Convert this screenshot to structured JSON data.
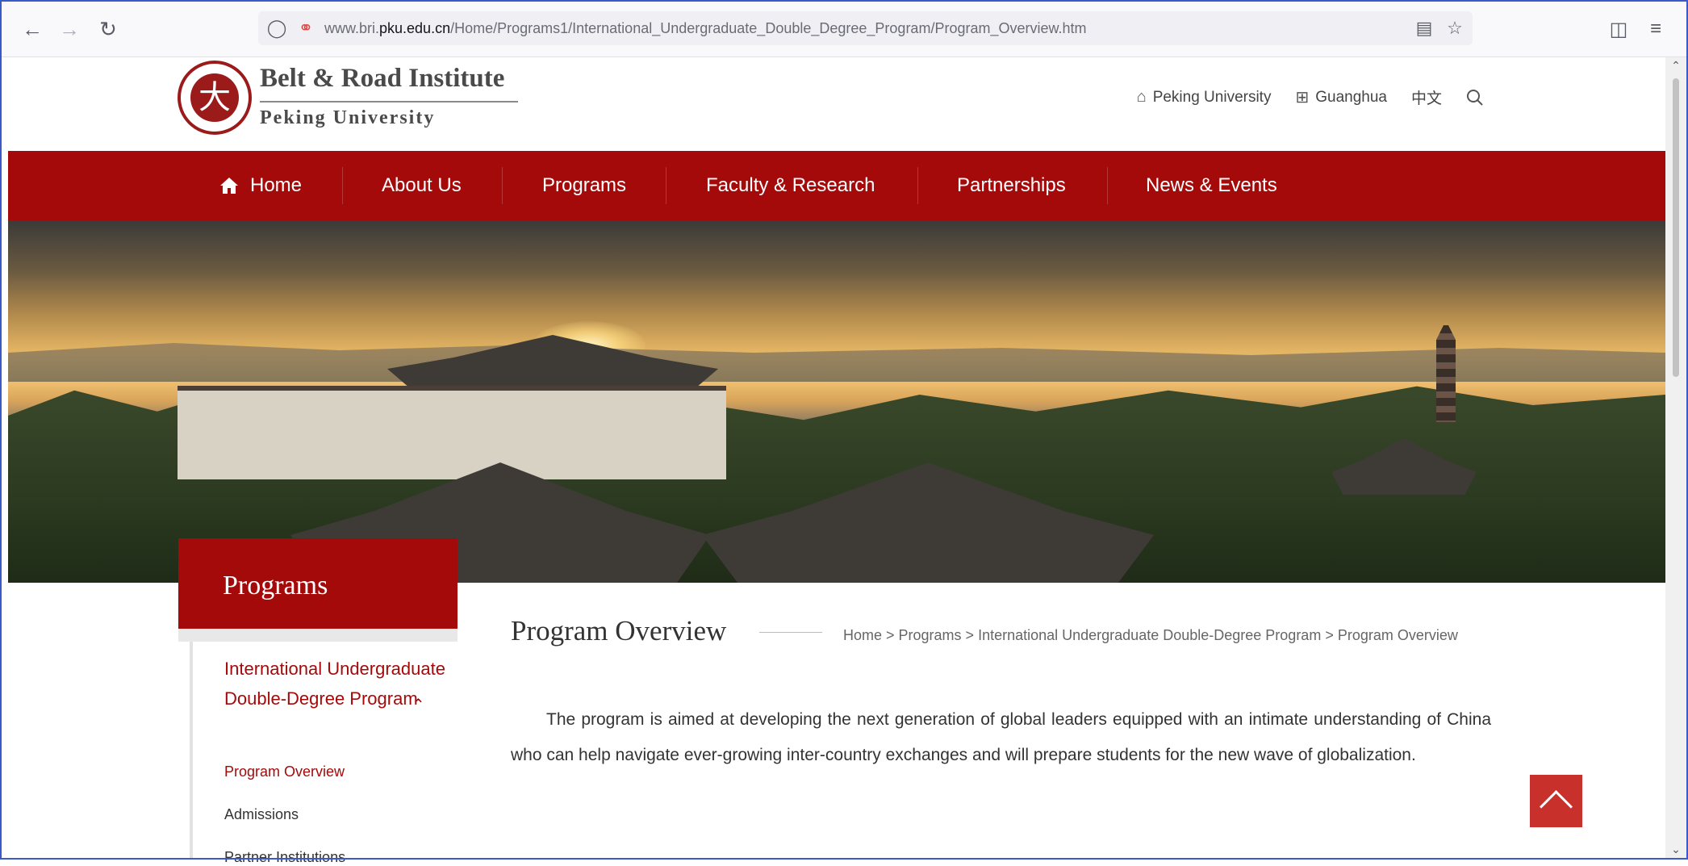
{
  "browser": {
    "nav_back_icon": "arrow-left-icon",
    "nav_forward_icon": "arrow-right-icon",
    "reload_icon": "reload-icon",
    "url_prefix": "www.bri.",
    "url_domain": "pku.edu.cn",
    "url_path": "/Home/Programs1/International_Undergraduate_Double_Degree_Program/Program_Overview.htm",
    "right_icons": [
      "reader-view-icon",
      "bookmark-star-icon",
      "pocket-icon",
      "menu-icon"
    ]
  },
  "header": {
    "logo_title": "Belt & Road Institute",
    "logo_subtitle": "Peking University",
    "seal_glyph": "北大",
    "links": [
      {
        "label": "Peking University",
        "icon": "home-building-icon"
      },
      {
        "label": "Guanghua",
        "icon": "grid-icon"
      },
      {
        "label": "中文",
        "icon": ""
      }
    ]
  },
  "nav": {
    "home": "Home",
    "about": "About Us",
    "programs": "Programs",
    "faculty": "Faculty & Research",
    "partnerships": "Partnerships",
    "news": "News & Events"
  },
  "sidebar": {
    "heading": "Programs",
    "current_section": "International Undergraduate Double-Degree Program",
    "items": [
      {
        "label": "Program Overview",
        "active": true
      },
      {
        "label": "Admissions",
        "active": false
      },
      {
        "label": "Partner Institutions",
        "active": false
      }
    ]
  },
  "content": {
    "title": "Program Overview",
    "breadcrumb": "Home > Programs > International Undergraduate Double-Degree Program > Program Overview",
    "paragraph": "The program is aimed at developing the next generation of global leaders equipped with an intimate understanding of China who can help navigate ever-growing inter-country exchanges and will prepare students for the new wave of globalization."
  },
  "colors": {
    "brand_red": "#a50a0a",
    "to_top_red": "#c8302c"
  }
}
